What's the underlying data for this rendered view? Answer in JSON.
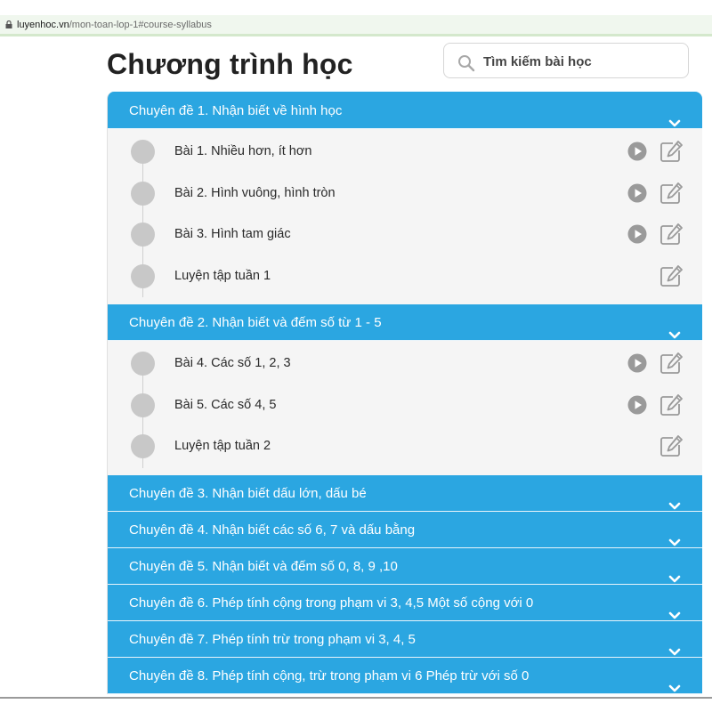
{
  "browser": {
    "url_host": "luyenhoc.vn",
    "url_path": "/mon-toan-lop-1#course-syllabus"
  },
  "page": {
    "title": "Chương trình học"
  },
  "search": {
    "placeholder": "Tìm kiếm bài học"
  },
  "topics": [
    {
      "label": "Chuyên đề 1. Nhận biết về hình học",
      "expanded": true,
      "lessons": [
        {
          "label": "Bài 1. Nhiều hơn, ít hơn",
          "has_video": true
        },
        {
          "label": "Bài 2. Hình vuông, hình tròn",
          "has_video": true
        },
        {
          "label": "Bài 3. Hình tam giác",
          "has_video": true
        },
        {
          "label": "Luyện tập tuần 1",
          "has_video": false
        }
      ]
    },
    {
      "label": "Chuyên đề 2. Nhận biết và đếm số từ 1 - 5",
      "expanded": true,
      "lessons": [
        {
          "label": "Bài 4. Các số 1, 2, 3",
          "has_video": true
        },
        {
          "label": "Bài 5. Các số 4, 5",
          "has_video": true
        },
        {
          "label": "Luyện tập tuần 2",
          "has_video": false
        }
      ]
    },
    {
      "label": "Chuyên đề 3. Nhận biết dấu lớn, dấu bé",
      "expanded": false
    },
    {
      "label": "Chuyên đề 4. Nhận biết các số 6, 7 và dấu bằng",
      "expanded": false
    },
    {
      "label": "Chuyên đề 5. Nhận biết và đếm số 0, 8, 9 ,10",
      "expanded": false
    },
    {
      "label": "Chuyên đề 6. Phép tính cộng trong phạm vi 3, 4,5 Một số cộng với 0",
      "expanded": false
    },
    {
      "label": "Chuyên đề 7. Phép tính trừ trong phạm vi 3, 4, 5",
      "expanded": false
    },
    {
      "label": "Chuyên đề 8. Phép tính cộng, trừ trong phạm vi 6 Phép trừ với số 0",
      "expanded": false
    }
  ],
  "icons": {
    "lock": "lock-icon",
    "search": "search-icon",
    "chevron": "chevron-down-icon",
    "play": "play-icon",
    "edit": "edit-icon",
    "node": "timeline-dot"
  },
  "colors": {
    "header_bg": "#2ba6e1",
    "header_text": "#ffffff",
    "panel_bg": "#f5f5f5",
    "icon_gray": "#9a9a9a",
    "dot_gray": "#c8c8c8"
  }
}
